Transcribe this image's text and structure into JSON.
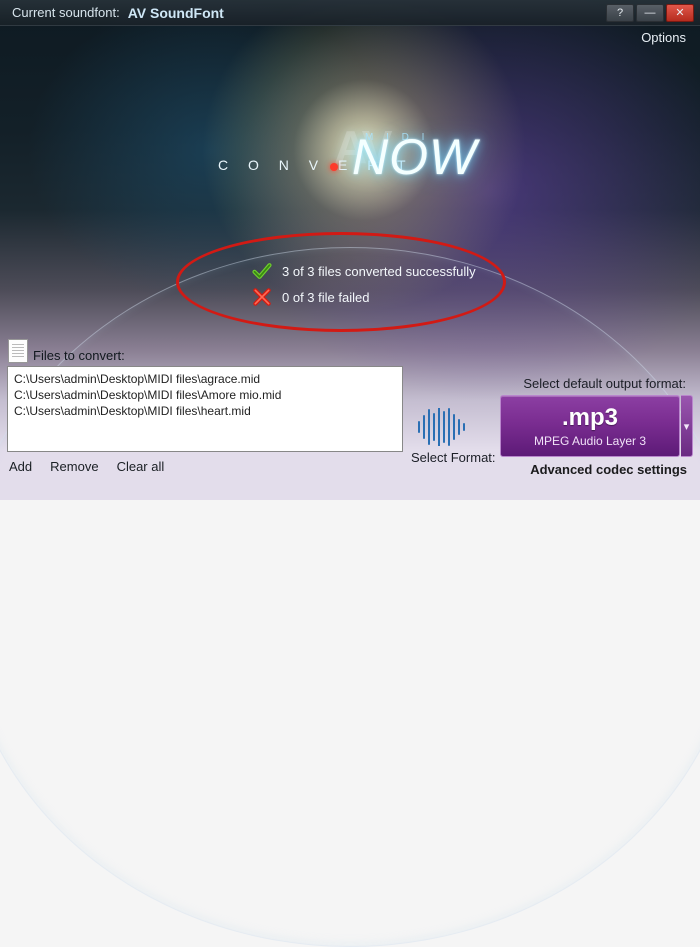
{
  "titlebar": {
    "label": "Current soundfont:",
    "value": "AV SoundFont"
  },
  "options_link": "Options",
  "logo": {
    "convert": "C O N V E R T",
    "midi": "M I D I",
    "av": "AV",
    "now": "NOW"
  },
  "status": {
    "success_text": "3 of 3 files converted successfully",
    "failed_text": "0 of 3 file failed"
  },
  "files": {
    "header": "Files to convert:",
    "items": [
      "C:\\Users\\admin\\Desktop\\MIDI files\\agrace.mid",
      "C:\\Users\\admin\\Desktop\\MIDI files\\Amore mio.mid",
      "C:\\Users\\admin\\Desktop\\MIDI files\\heart.mid"
    ]
  },
  "actions": {
    "add": "Add",
    "remove": "Remove",
    "clear_all": "Clear all"
  },
  "right": {
    "default_label": "Select default output format:",
    "select_label": "Select Format:",
    "format_ext": ".mp3",
    "format_desc": "MPEG Audio Layer 3",
    "advanced": "Advanced codec settings"
  }
}
